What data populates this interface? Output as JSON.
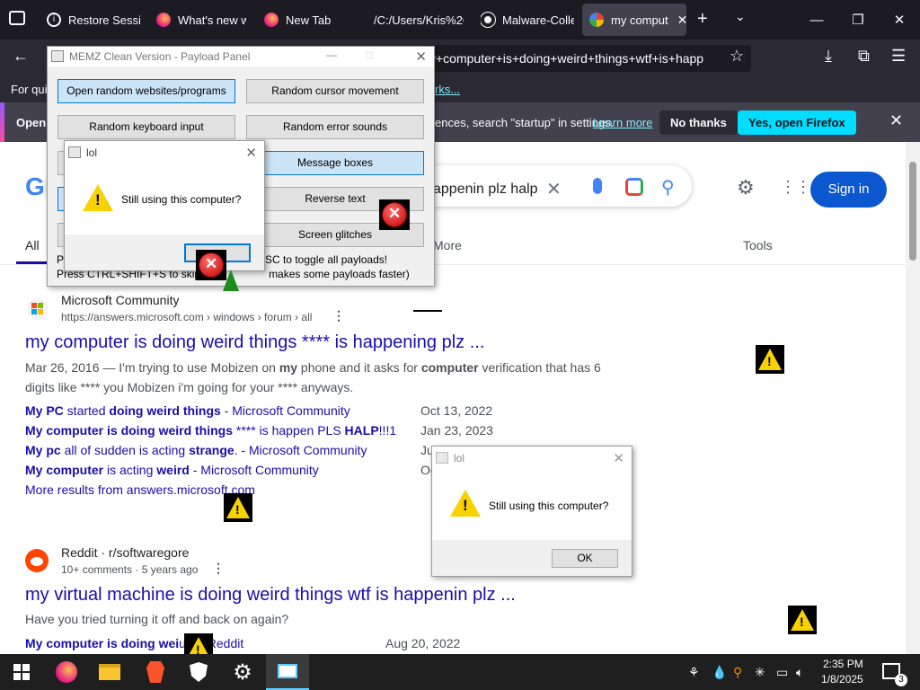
{
  "browser": {
    "tabs": [
      {
        "label": "Restore Session",
        "icon": "info-icon"
      },
      {
        "label": "What's new w",
        "icon": "firefox-icon"
      },
      {
        "label": "New Tab",
        "icon": "firefox-icon"
      },
      {
        "label": "/C:/Users/Kris%20(",
        "icon": "file-icon"
      },
      {
        "label": "Malware-Colle",
        "icon": "github-icon"
      },
      {
        "label": "my comput",
        "icon": "google-icon"
      }
    ],
    "url_text": "y+computer+is+doing+weird+things+wtf+is+happ",
    "bookmark_prefix": "For quic",
    "bookmark_link": "rks...",
    "notification": {
      "prefix": "Open",
      "text": "ences, search \"startup\" in settings.",
      "learn_more": "Learn more",
      "no_thanks": "No thanks",
      "yes": "Yes, open Firefox"
    }
  },
  "google": {
    "search_text": "appenin plz halp",
    "sign_in": "Sign in",
    "tabs": {
      "all": "All",
      "more": "More",
      "tools": "Tools"
    },
    "result1": {
      "site": "Microsoft Community",
      "crumb": "https://answers.microsoft.com › windows › forum › all",
      "title": "my computer is doing weird things **** is happening plz ...",
      "snippet_pre": "Mar 26, 2016 — I'm trying to use Mobizen on ",
      "snippet_b1": "my",
      "snippet_mid": " phone and it asks for ",
      "snippet_b2": "computer",
      "snippet_post": " verification that has 6 digits like **** you Mobizen i'm going for your **** anyways.",
      "links": [
        {
          "b": "My PC",
          "t1": " started ",
          "b2": "doing weird things",
          "t2": " - Microsoft Community",
          "date": "Oct 13, 2022"
        },
        {
          "b": "My computer is doing weird things",
          "t1": " **** is happen PLS ",
          "b2": "HALP",
          "t2": "!!!1",
          "date": "Jan 23, 2023"
        },
        {
          "b": "My pc",
          "t1": " all of sudden is acting ",
          "b2": "strange",
          "t2": ". - Microsoft Community",
          "date": "Ju"
        },
        {
          "b": "My computer",
          "t1": " is acting ",
          "b2": "weird",
          "t2": " - Microsoft Community",
          "date": "Oc"
        }
      ],
      "more": "More results from answers.microsoft.com"
    },
    "result2": {
      "site": "Reddit · r/softwaregore",
      "crumb": "10+ comments · 5 years ago",
      "title": "my virtual machine is doing weird things wtf is happenin plz ...",
      "snippet": "Have you tried turning it off and back on again?",
      "link_b": "My computer is doing wei",
      "link_t": "uff. - Reddit",
      "date": "Aug 20, 2022"
    }
  },
  "memz": {
    "title": "MEMZ Clean Version - Payload Panel",
    "buttons": [
      "Open random websites/programs",
      "Random cursor movement",
      "Random keyboard input",
      "Random error sounds",
      "Message boxes",
      "Reverse text",
      "Screen glitches"
    ],
    "help1": "ESC to toggle all payloads!",
    "help1_prefix": "Pa",
    "help2": "Press CTRL+SHIFT+S to skip so                  makes some payloads faster)"
  },
  "dialog1": {
    "title": "lol",
    "message": "Still using this computer?",
    "ok": ""
  },
  "dialog2": {
    "title": "lol",
    "message": "Still using this computer?",
    "ok": "OK"
  },
  "taskbar": {
    "time": "2:35 PM",
    "date": "1/8/2025",
    "notif_count": "3"
  },
  "colors": {
    "accent_blue": "#1a73e8",
    "link": "#1a0dab",
    "firefox_cyan": "#00ddff",
    "warn": "#f8d200",
    "err": "#c00000"
  }
}
